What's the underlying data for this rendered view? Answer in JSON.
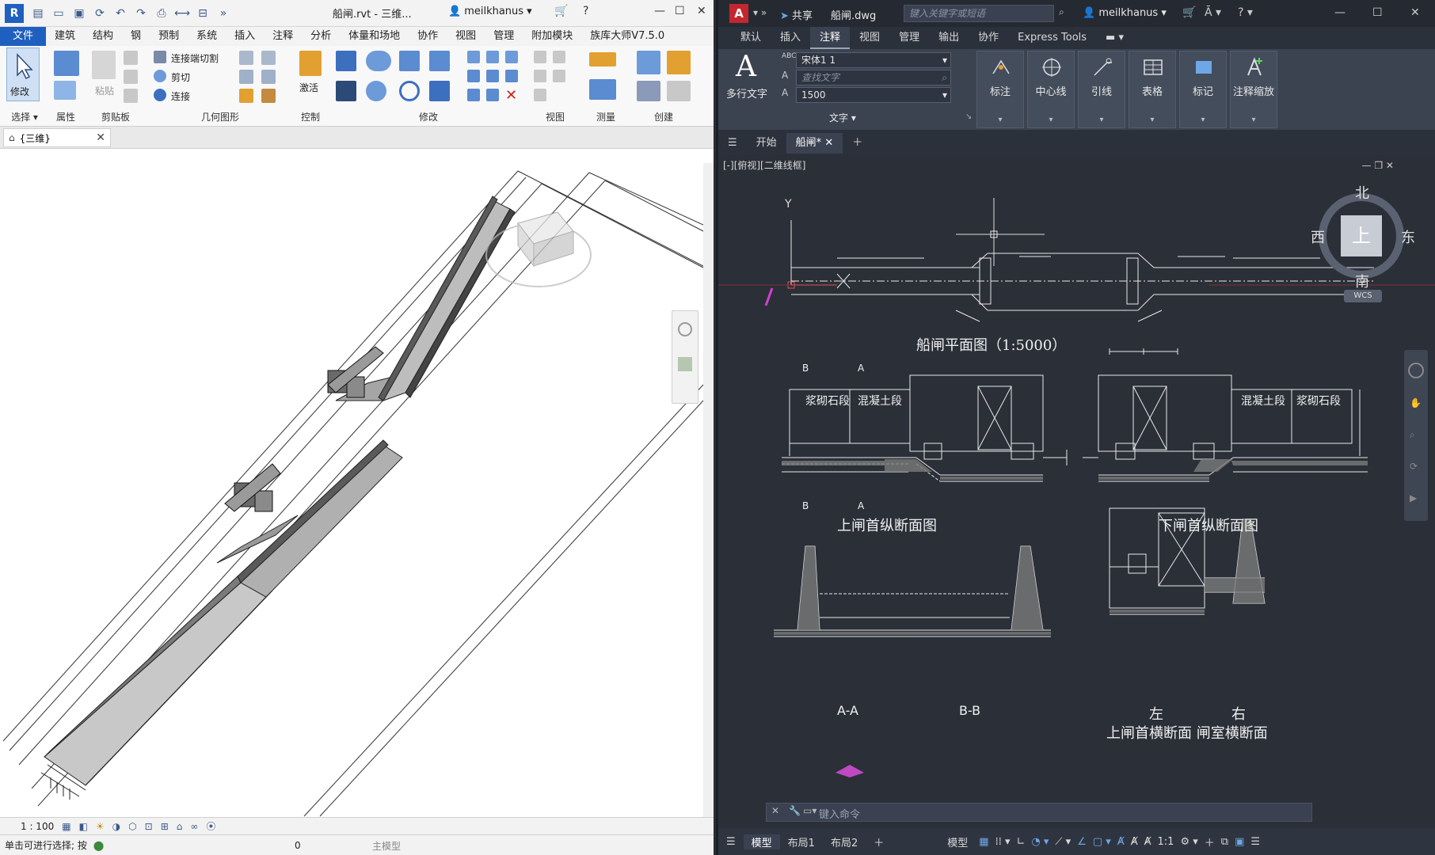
{
  "revit": {
    "title_doc": "船闸.rvt - 三维...",
    "user": "meilkhanus",
    "menu": [
      "文件",
      "建筑",
      "结构",
      "钢",
      "预制",
      "系统",
      "插入",
      "注释",
      "分析",
      "体量和场地",
      "协作",
      "视图",
      "管理",
      "附加模块",
      "族库大师V7.5.0"
    ],
    "ribbon": {
      "modify": "修改",
      "select": "选择 ▾",
      "properties": "属性",
      "clipboard": "剪贴板",
      "paste": "粘贴",
      "cut_join": "连接端切割",
      "cut": "剪切",
      "join": "连接",
      "geometry": "几何图形",
      "activate": "激活",
      "control": "控制",
      "modify_group": "修改",
      "view": "视图",
      "measure": "测量",
      "create": "创建"
    },
    "view_tab": "{三维}",
    "scale": "1 : 100",
    "status_text": "单击可进行选择; 按",
    "workset": "0",
    "main_model": "主模型"
  },
  "cad": {
    "share": "共享",
    "doc": "船闸.dwg",
    "search_placeholder": "键入关键字或短语",
    "user": "meilkhanus",
    "menu": [
      "默认",
      "插入",
      "注释",
      "视图",
      "管理",
      "输出",
      "协作",
      "Express Tools"
    ],
    "ribbon": {
      "mtext": "多行文字",
      "font": "宋体1 1",
      "find_placeholder": "查找文字",
      "height": "1500",
      "text_panel": "文字 ▾",
      "dimension": "标注",
      "centerline": "中心线",
      "leader": "引线",
      "table": "表格",
      "markup": "标记",
      "annot_scale": "注释缩放"
    },
    "tabs": [
      "开始",
      "船闸*"
    ],
    "view_label": "[-][俯视][二维线框]",
    "viewcube": {
      "north": "北",
      "south": "南",
      "east": "东",
      "west": "西",
      "top": "上",
      "wcs": "WCS"
    },
    "drawing": {
      "plan_title": "船闸平面图（1:5000）",
      "upper_long": "上闸首纵断面图",
      "lower_long": "下闸首纵断面图",
      "aa": "A-A",
      "bb": "B-B",
      "left": "左",
      "right": "右",
      "cross_title": "上闸首横断面 闸室横断面",
      "masonry": "浆砌石段",
      "concrete": "混凝土段",
      "b_mark": "B",
      "a_mark": "A",
      "y_axis": "Y"
    },
    "command_placeholder": "键入命令",
    "status_tabs": [
      "模型",
      "布局1",
      "布局2"
    ],
    "status_model": "模型",
    "status_scale": "1:1"
  }
}
